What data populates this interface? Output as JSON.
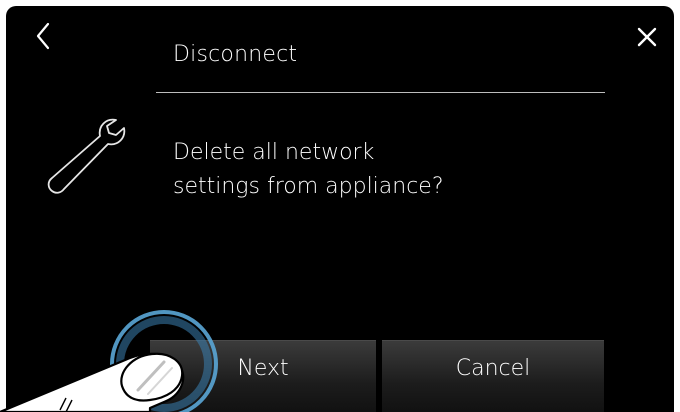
{
  "header": {
    "title": "Disconnect",
    "back_icon": "chevron-left-icon",
    "close_icon": "close-icon"
  },
  "content": {
    "icon": "wrench-icon",
    "message_lines": [
      "Delete all network",
      "settings from appliance?"
    ]
  },
  "buttons": {
    "next_label": "Next",
    "cancel_label": "Cancel"
  },
  "colors": {
    "background": "#000000",
    "text": "#ffffff",
    "divider": "#bdbdbd",
    "button_top": "#3b3b3b",
    "button_bottom": "#111111",
    "touch_ring": "#5aa6d6"
  }
}
